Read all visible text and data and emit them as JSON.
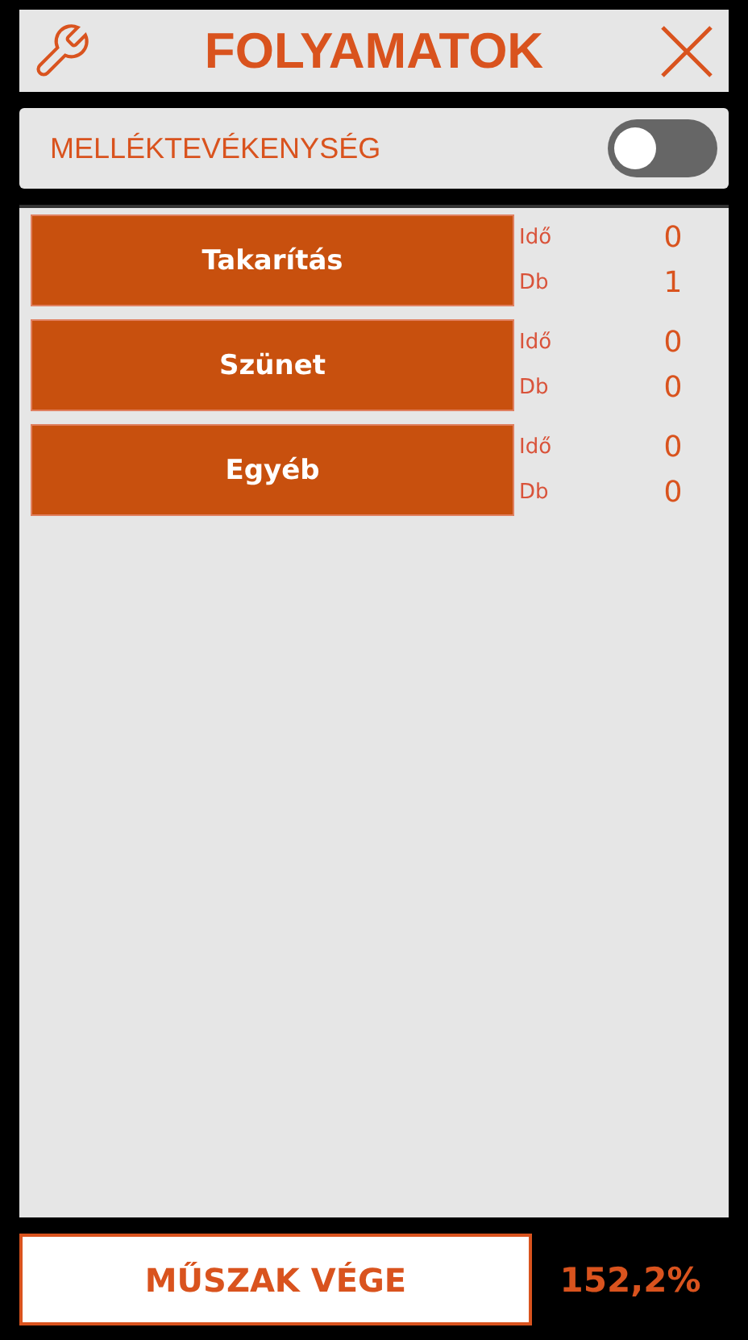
{
  "header": {
    "title": "FOLYAMATOK"
  },
  "side_activity": {
    "label": "MELLÉKTEVÉKENYSÉG",
    "on": false
  },
  "processes": [
    {
      "name": "Takarítás",
      "time_label": "Idő",
      "time": "0",
      "count_label": "Db",
      "count": "1"
    },
    {
      "name": "Szünet",
      "time_label": "Idő",
      "time": "0",
      "count_label": "Db",
      "count": "0"
    },
    {
      "name": "Egyéb",
      "time_label": "Idő",
      "time": "0",
      "count_label": "Db",
      "count": "0"
    }
  ],
  "footer": {
    "button": "MŰSZAK VÉGE",
    "percent": "152,2%"
  }
}
